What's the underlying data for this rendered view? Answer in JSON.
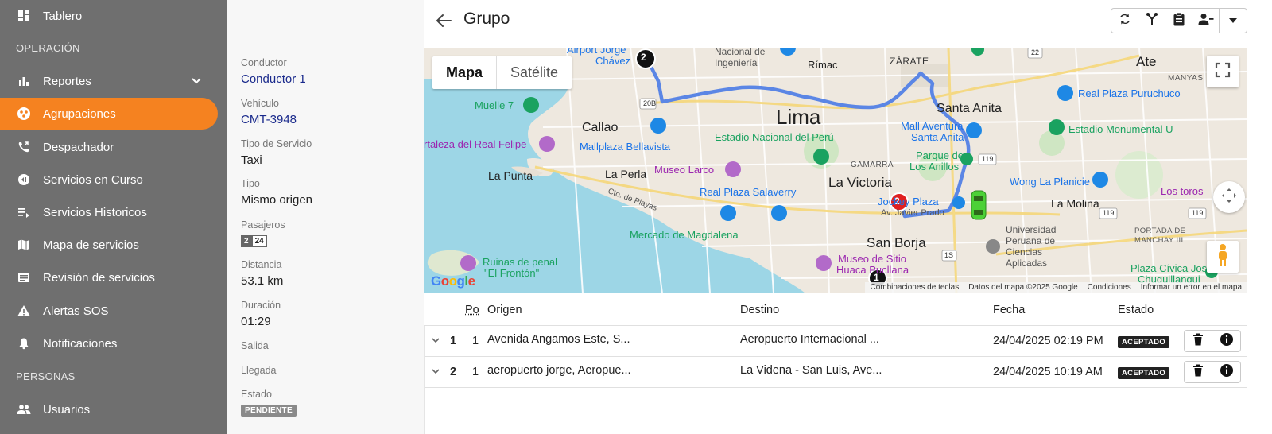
{
  "sidebar": {
    "items": [
      {
        "label": "Tablero",
        "icon": "dashboard-icon"
      },
      {
        "label": "Reportes",
        "icon": "bar-chart-icon"
      },
      {
        "label": "Agrupaciones",
        "icon": "group-work-icon"
      },
      {
        "label": "Despachador",
        "icon": "phone-forwarded-icon"
      },
      {
        "label": "Servicios en Curso",
        "icon": "in-progress-icon"
      },
      {
        "label": "Servicios Historicos",
        "icon": "history-list-icon"
      },
      {
        "label": "Mapa de servicios",
        "icon": "map-icon"
      },
      {
        "label": "Revisión de servicios",
        "icon": "review-icon"
      },
      {
        "label": "Alertas SOS",
        "icon": "warning-icon"
      },
      {
        "label": "Notificaciones",
        "icon": "bell-icon"
      },
      {
        "label": "Usuarios",
        "icon": "people-icon"
      }
    ],
    "sections": {
      "operacion": "OPERACIÓN",
      "personas": "PERSONAS"
    },
    "active_color": "#f58220"
  },
  "details": {
    "conductor_label": "Conductor",
    "conductor_value": "Conductor 1",
    "vehiculo_label": "Vehículo",
    "vehiculo_value": "CMT-3948",
    "tipo_servicio_label": "Tipo de Servicio",
    "tipo_servicio_value": "Taxi",
    "tipo_label": "Tipo",
    "tipo_value": "Mismo origen",
    "pasajeros_label": "Pasajeros",
    "pasajeros_a": "2",
    "pasajeros_b": "24",
    "distancia_label": "Distancia",
    "distancia_value": "53.1 km",
    "duracion_label": "Duración",
    "duracion_value": "01:29",
    "salida_label": "Salida",
    "llegada_label": "Llegada",
    "estado_label": "Estado",
    "estado_value": "PENDIENTE"
  },
  "header": {
    "title": "Grupo"
  },
  "map": {
    "type_map": "Mapa",
    "type_satellite": "Satélite",
    "google": "Google",
    "attribution": [
      "Combinaciones de teclas",
      "Datos del mapa ©2025 Google",
      "Condiciones",
      "Informar un error en el mapa"
    ],
    "labels": {
      "lima": "Lima",
      "callao": "Callao",
      "la_victoria": "La Victoria",
      "san_borja": "San Borja",
      "santa_anita": "Santa Anita",
      "ate": "Ate",
      "la_molina": "La Molina",
      "la_punta": "La Punta",
      "la_perla": "La Perla",
      "rimac": "Rímac",
      "zarate": "ZÁRATE",
      "airport": "Airport Jorge",
      "chavez": "Chávez",
      "muelle": "Muelle 7",
      "fortaleza": "rtaleza del Real Felipe",
      "mallplaza": "Mallplaza Bellavista",
      "museo_larco": "Museo Larco",
      "estadio_nacional": "Estadio Nacional del Perú",
      "real_plaza_salaverry": "Real Plaza Salaverry",
      "mercado": "Mercado de Magdalena",
      "ruinas1": "Ruinas de penal",
      "ruinas2": "\"El Frontón\"",
      "museo_sitio1": "Museo de Sitio",
      "museo_sitio2": "Huaca Pucllana",
      "jockey": "Jockey Plaza",
      "mall_aventura1": "Mall Aventura",
      "mall_aventura2": "Santa Anita",
      "parque1": "Parque de",
      "parque2": "Los Anillos",
      "real_plaza_puruchuco": "Real Plaza Puruchuco",
      "estadio_monumental": "Estadio Monumental U",
      "wong": "Wong La Planicie",
      "toros": "Los toros",
      "upc1": "Universidad",
      "upc2": "Peruana de",
      "upc3": "Ciencias",
      "upc4": "Aplicadas",
      "plaza_civica1": "Plaza Cívica José",
      "plaza_civica2": "Chuquillanqui",
      "nacional1": "Nacional de",
      "nacional2": "Ingeniería",
      "manyas": "MANYAS",
      "gamarra": "GAMARRA",
      "portada1": "PORTADA DE",
      "portada2": "MANCHAY III",
      "javier_prado": "Av. Javier Prado",
      "cto_playas": "Cto. de Playas",
      "r20b": "20B",
      "r22": "22",
      "r119a": "119",
      "r119b": "119",
      "r1s": "1S",
      "r119c": "119"
    },
    "markers": {
      "start": "2",
      "red": "2",
      "bottom": "1"
    }
  },
  "table": {
    "headers": {
      "pos": "Po",
      "origen": "Origen",
      "destino": "Destino",
      "fecha": "Fecha",
      "estado": "Estado"
    },
    "rows": [
      {
        "index": "1",
        "pax": "1",
        "origen": "Avenida Angamos Este, S...",
        "destino": "Aeropuerto Internacional ...",
        "fecha": "24/04/2025 02:19 PM",
        "estado": "ACEPTADO"
      },
      {
        "index": "2",
        "pax": "1",
        "origen": "aeropuerto jorge, Aeropue...",
        "destino": "La Videna - San Luis, Ave...",
        "fecha": "24/04/2025 10:19 AM",
        "estado": "ACEPTADO"
      }
    ]
  }
}
